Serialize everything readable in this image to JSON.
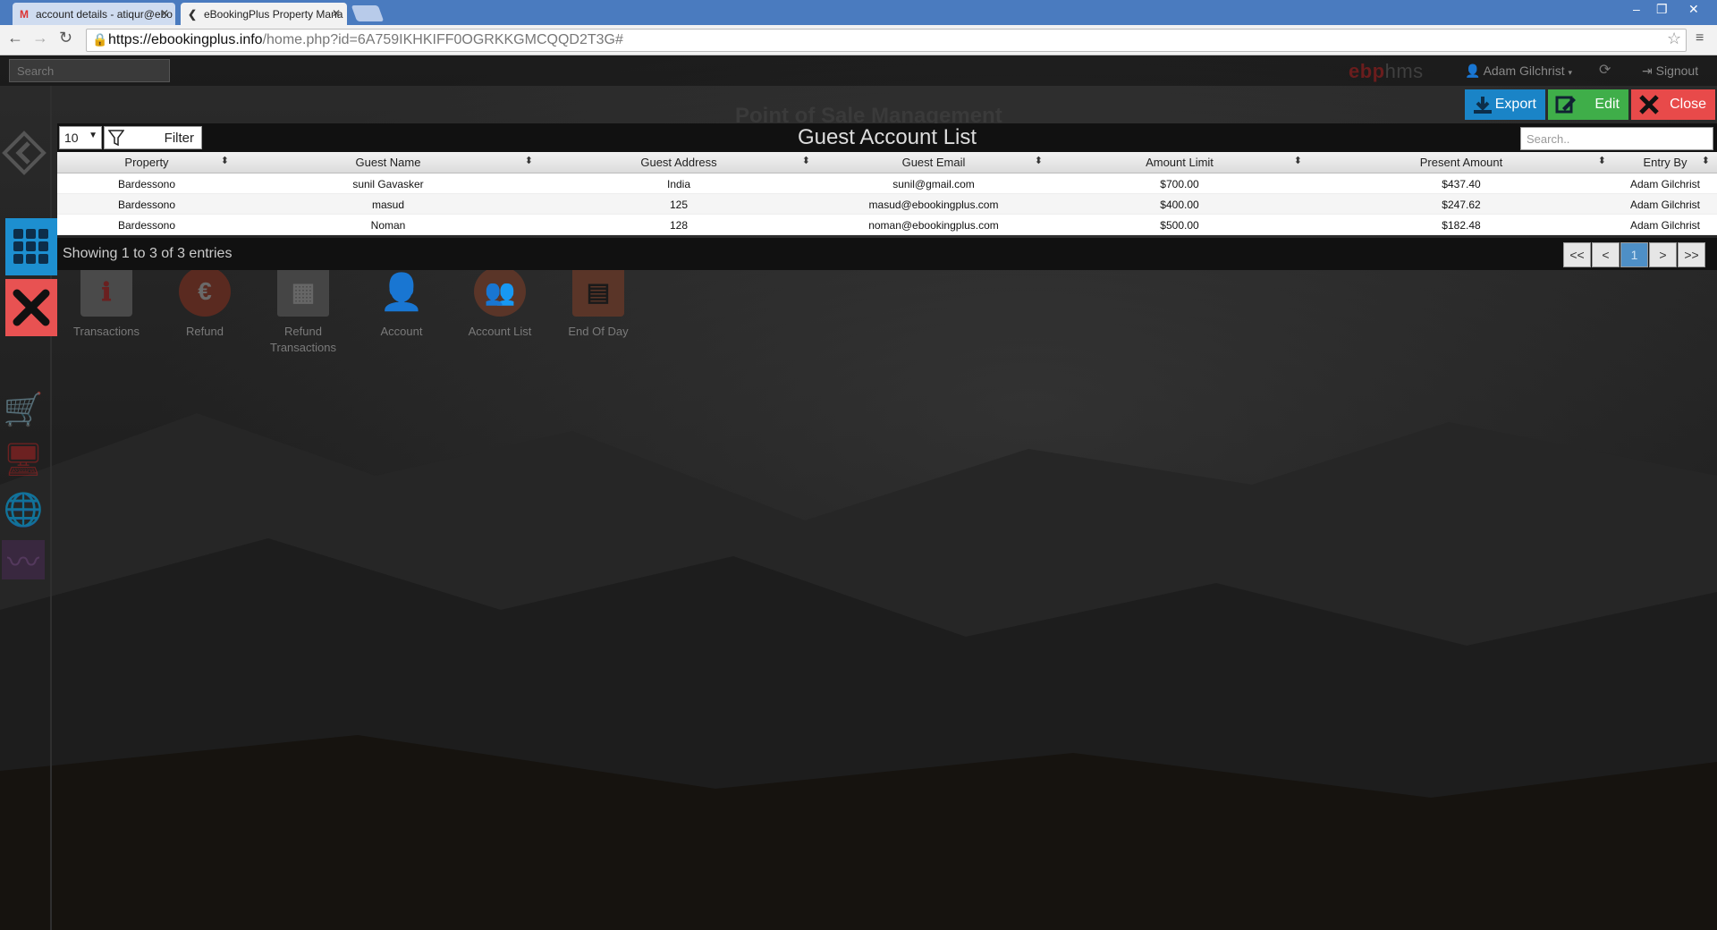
{
  "browser": {
    "tabs": [
      {
        "title": "account details - atiqur@ebo",
        "icon": "gmail-icon"
      },
      {
        "title": "eBookingPlus Property Mana",
        "icon": "ebp-icon"
      }
    ],
    "url_scheme": "https://",
    "url_host": "ebookingplus.info",
    "url_path": "/home.php?id=6A759IKHKIFF0OGRKKGMCQQD2T3G#"
  },
  "topbar": {
    "search_placeholder": "Search",
    "brand_a": "ebp",
    "brand_b": "hms",
    "user_name": "Adam Gilchrist",
    "signout_label": "Signout"
  },
  "module": {
    "title": "Point of Sale Management",
    "tiles": [
      {
        "label": "Transactions"
      },
      {
        "label": "Refund"
      },
      {
        "label": "Refund Transactions"
      },
      {
        "label": "Account"
      },
      {
        "label": "Account List"
      },
      {
        "label": "End Of Day"
      }
    ]
  },
  "modal": {
    "actions": {
      "export": "Export",
      "edit": "Edit",
      "close": "Close"
    },
    "page_size": "10",
    "filter_label": "Filter",
    "title": "Guest Account List",
    "search_placeholder": "Search..",
    "columns": [
      "Property",
      "Guest Name",
      "Guest Address",
      "Guest Email",
      "Amount Limit",
      "Present Amount",
      "Entry By"
    ],
    "rows": [
      [
        "Bardessono",
        "sunil Gavasker",
        "India",
        "sunil@gmail.com",
        "$700.00",
        "$437.40",
        "Adam Gilchrist"
      ],
      [
        "Bardessono",
        "masud",
        "125",
        "masud@ebookingplus.com",
        "$400.00",
        "$247.62",
        "Adam Gilchrist"
      ],
      [
        "Bardessono",
        "Noman",
        "128",
        "noman@ebookingplus.com",
        "$500.00",
        "$182.48",
        "Adam Gilchrist"
      ]
    ],
    "info": "Showing 1 to 3 of 3 entries",
    "pager": {
      "first": "<<",
      "prev": "<",
      "current": "1",
      "next": ">",
      "last": ">>"
    }
  },
  "colors": {
    "export": "#1a84c7",
    "edit": "#3fae49",
    "close": "#e84a4a",
    "rail_grid": "#1d8fd0",
    "rail_close": "#e85252"
  }
}
